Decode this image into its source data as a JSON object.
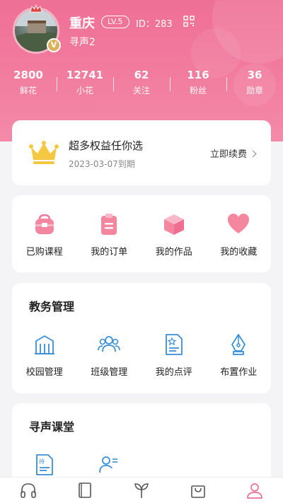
{
  "profile": {
    "name": "重庆",
    "level": "LV.5",
    "id_text": "ID：283",
    "subtitle": "寻声2",
    "vip_mark": "V"
  },
  "stats": [
    {
      "value": "2800",
      "label": "鲜花"
    },
    {
      "value": "12741",
      "label": "小花"
    },
    {
      "value": "62",
      "label": "关注"
    },
    {
      "value": "116",
      "label": "粉丝"
    },
    {
      "value": "36",
      "label": "勋章"
    }
  ],
  "vip": {
    "title": "超多权益任你选",
    "expiry": "2023-03-07到期",
    "renew_label": "立即续费"
  },
  "quick_actions": [
    {
      "label": "已购课程",
      "icon": "bag-icon"
    },
    {
      "label": "我的订单",
      "icon": "clipboard-icon"
    },
    {
      "label": "我的作品",
      "icon": "box-icon"
    },
    {
      "label": "我的收藏",
      "icon": "heart-icon"
    }
  ],
  "education": {
    "title": "教务管理",
    "items": [
      {
        "label": "校园管理",
        "icon": "school-icon"
      },
      {
        "label": "班级管理",
        "icon": "group-icon"
      },
      {
        "label": "我的点评",
        "icon": "document-star-icon"
      },
      {
        "label": "布置作业",
        "icon": "pen-nib-icon"
      }
    ]
  },
  "classroom": {
    "title": "寻声课堂",
    "items": [
      {
        "icon": "pending-document-icon",
        "badge": "待"
      },
      {
        "icon": "user-list-icon"
      }
    ]
  },
  "tabbar": [
    {
      "icon": "headphones-icon",
      "active": false
    },
    {
      "icon": "book-icon",
      "active": false
    },
    {
      "icon": "sprout-icon",
      "active": false
    },
    {
      "icon": "shopping-bag-icon",
      "active": false
    },
    {
      "icon": "profile-icon",
      "active": true
    }
  ],
  "colors": {
    "brand_pink": "#ef6f96",
    "icon_blue": "#3a8fd6",
    "crown_gold": "#f5c842"
  }
}
